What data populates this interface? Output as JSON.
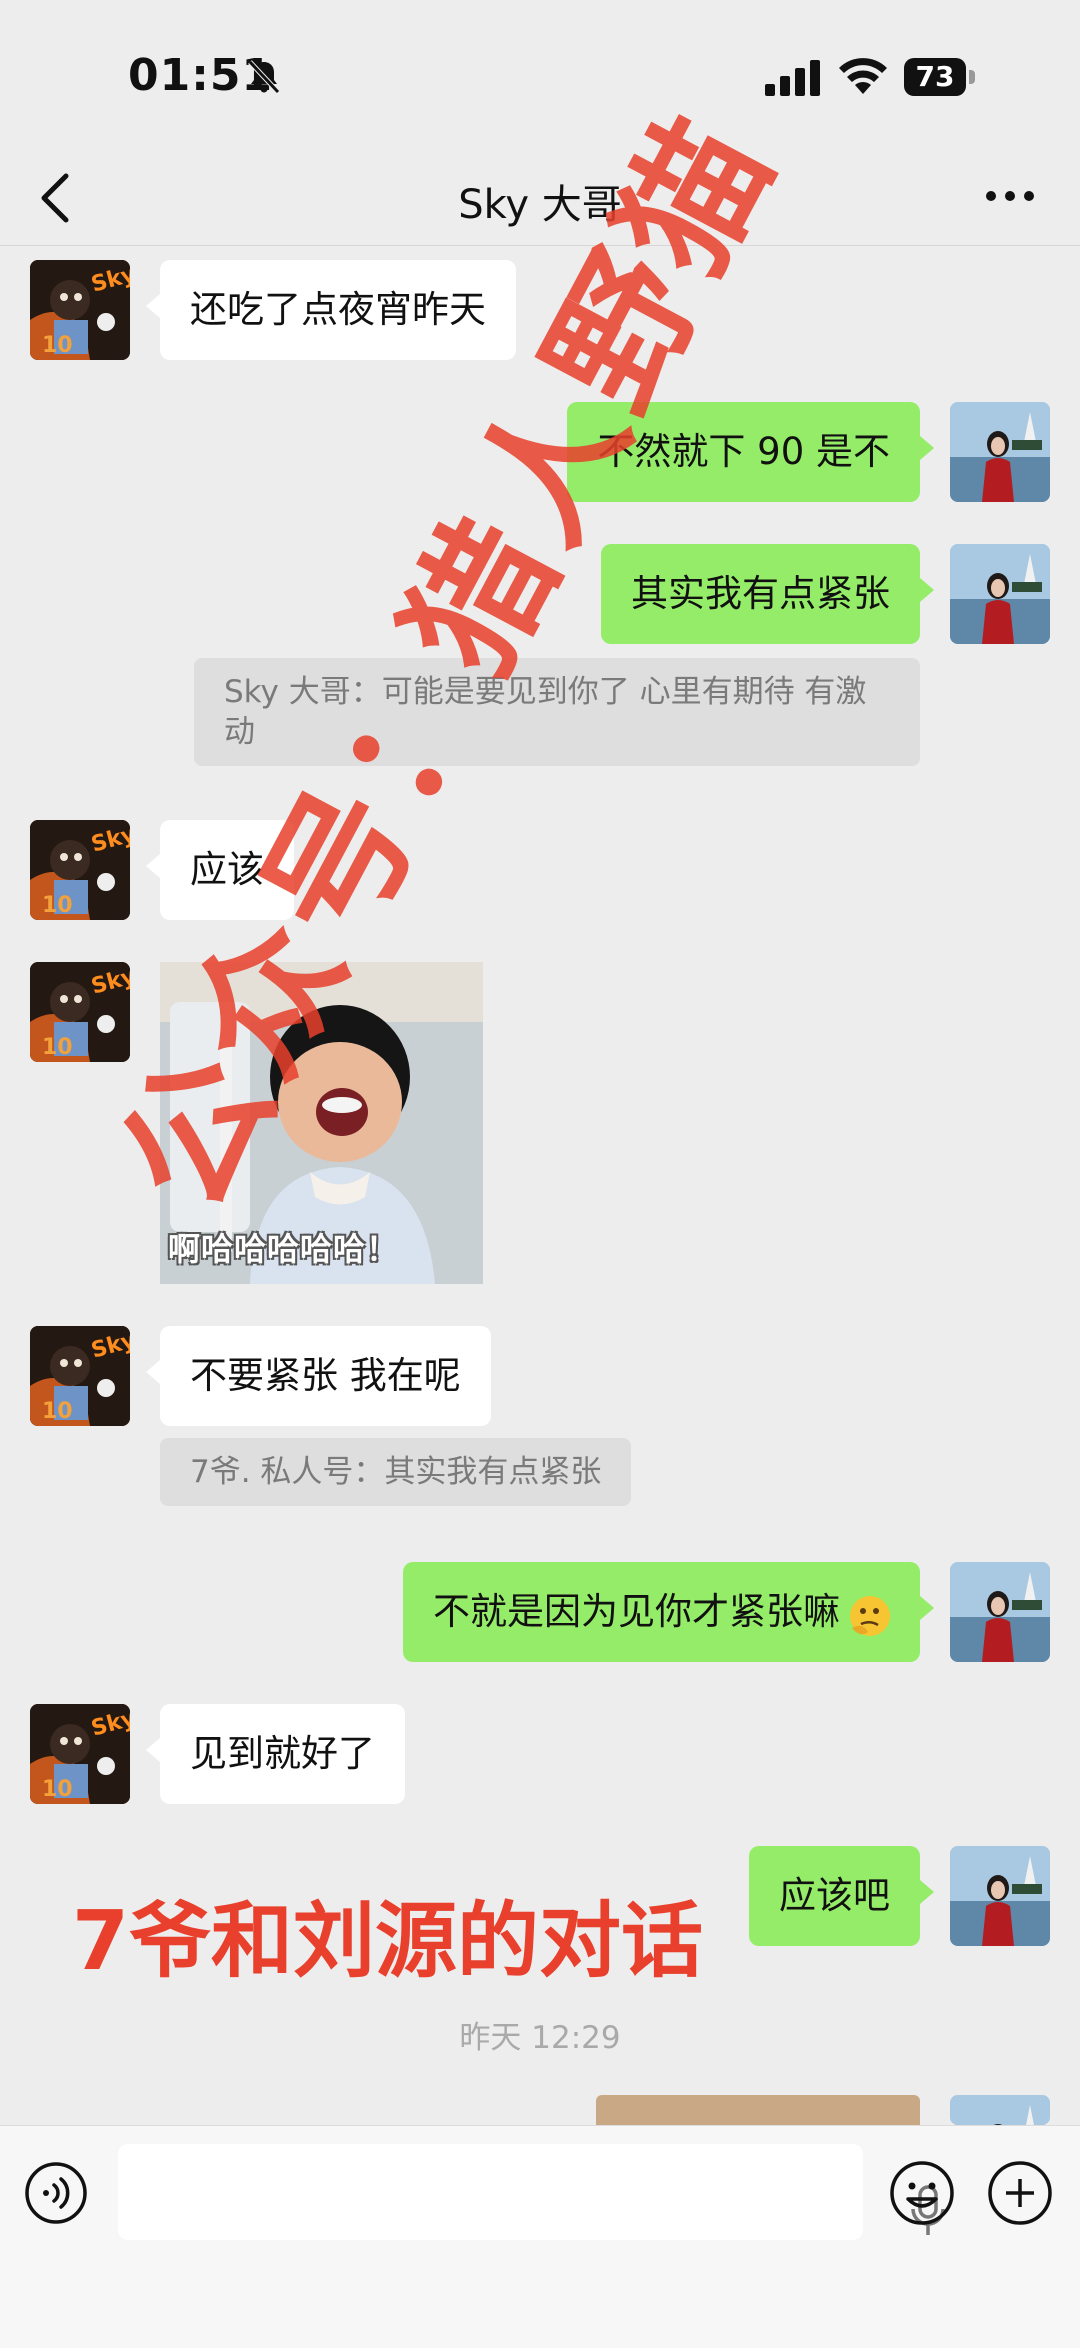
{
  "status_bar": {
    "time": "01:51",
    "battery": "73"
  },
  "nav": {
    "title": "Sky 大哥"
  },
  "messages": {
    "m1": "还吃了点夜宵昨天",
    "m2": "不然就下 90 是不",
    "m3": "其实我有点紧张",
    "q1": "Sky 大哥：可能是要见到你了 心里有期待 有激动",
    "m4": "应该",
    "sticker_caption": "啊哈哈哈哈哈！",
    "m5": "不要紧张 我在呢",
    "q2": "7爷. 私人号：其实我有点紧张",
    "m6": "不就是因为见你才紧张嘛",
    "m7": "见到就好了",
    "m8": "应该吧"
  },
  "timestamp": "昨天 12:29",
  "watermark": {
    "big": "公众号：猎人野猫",
    "caption": "7爷和刘源的对话"
  },
  "icons": {
    "back": "back-chevron-icon",
    "more": "more-dots-icon",
    "voice": "voice-input-icon",
    "mic": "microphone-icon",
    "emoji": "emoji-icon",
    "plus": "plus-icon",
    "mute": "bell-slash-icon"
  },
  "colors": {
    "green_bubble": "#95ec69",
    "background": "#ededed",
    "watermark": "#e8402c"
  }
}
